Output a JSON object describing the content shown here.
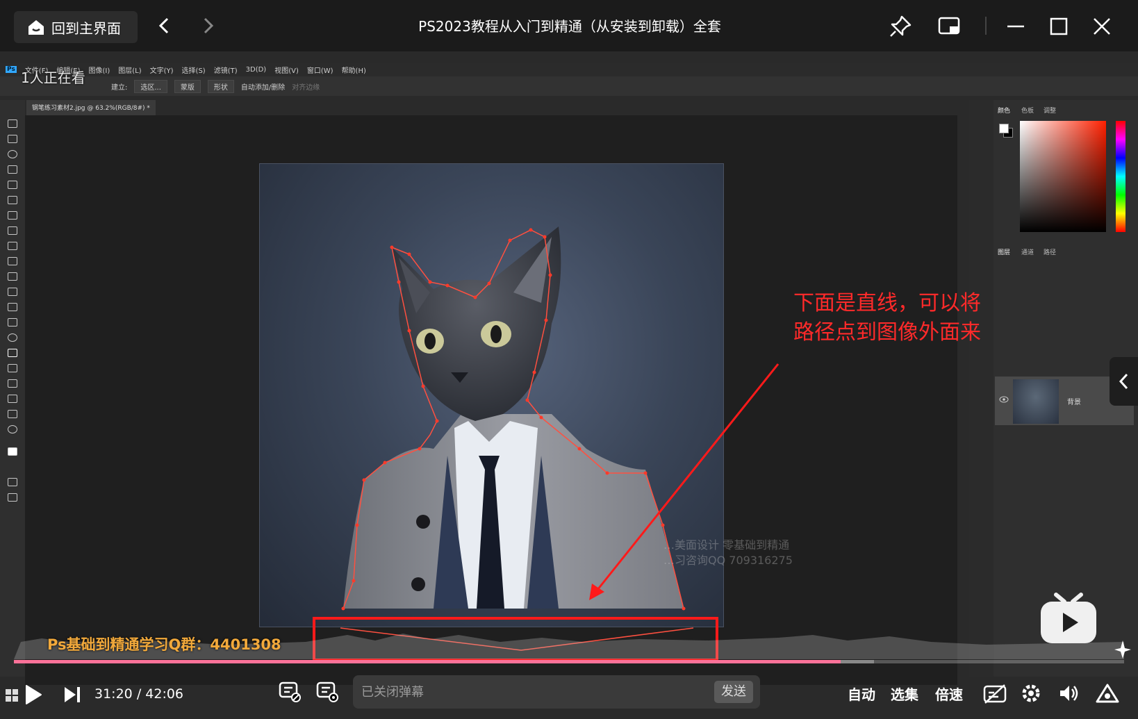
{
  "titlebar": {
    "home_label": "回到主界面",
    "title": "PS2023教程从入门到精通（从安装到卸载）全套"
  },
  "photoshop": {
    "menu": [
      "文件(F)",
      "编辑(E)",
      "图像(I)",
      "图层(L)",
      "文字(Y)",
      "选择(S)",
      "滤镜(T)",
      "3D(D)",
      "视图(V)",
      "窗口(W)",
      "帮助(H)"
    ],
    "options": [
      "建立:",
      "选区...",
      "蒙版",
      "形状",
      "自动添加/删除",
      "对齐边缘"
    ],
    "doc_tab": "钢笔练习素材2.jpg @ 63.2%(RGB/8#) *",
    "panel_tabs_top": [
      "颜色",
      "色板",
      "调整"
    ],
    "panel_tabs_layers": [
      "图层",
      "通道",
      "路径"
    ],
    "layer_name": "背景"
  },
  "viewer_count": "1人正在看",
  "annotation": {
    "text": "下面是直线，可以将路径点到图像外面来",
    "color": "#ff2a2a"
  },
  "watermark": {
    "line1": "…美面设计 零基础到精通",
    "line2": "…习咨询QQ 709316275"
  },
  "qq_group": "Ps基础到精通学习Q群：4401308",
  "player": {
    "current_time": "31:20",
    "separator": "/",
    "duration": "42:06",
    "progress": 0.7445,
    "buffered": 0.7745,
    "danmaku_placeholder": "已关闭弹幕",
    "send_label": "发送",
    "auto_label": "自动",
    "episodes_label": "选集",
    "speed_label": "倍速",
    "accent": "#fb7299"
  }
}
